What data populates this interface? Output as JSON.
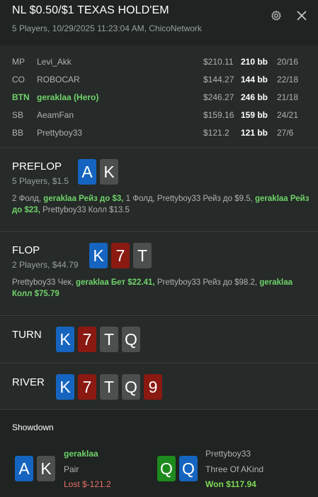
{
  "header": {
    "title": "NL $0.50/$1 TEXAS HOLD'EM",
    "subtitle": "5 Players, 10/29/2025 11:23:04 AM, ChicoNetwork",
    "icons": [
      "gear-icon",
      "close-icon"
    ]
  },
  "players": [
    {
      "pos": "MP",
      "name": "Levi_Akk",
      "stack": "$210.11",
      "bb": "210 bb",
      "hands": "20/16"
    },
    {
      "pos": "CO",
      "name": "ROBOCAR",
      "stack": "$144.27",
      "bb": "144 bb",
      "hands": "22/18"
    },
    {
      "pos": "BTN",
      "name": "geraklaa (Hero)",
      "stack": "$246.27",
      "bb": "246 bb",
      "hands": "21/18"
    },
    {
      "pos": "SB",
      "name": "AeamFan",
      "stack": "$159.16",
      "bb": "159 bb",
      "hands": "24/21"
    },
    {
      "pos": "BB",
      "name": "Prettyboy33",
      "stack": "$121.2",
      "bb": "121 bb",
      "hands": "27/6"
    }
  ],
  "preflop": {
    "title": "PREFLOP",
    "sub": "5 Players, $1.5",
    "cards": [
      "A",
      "K"
    ],
    "actions": [
      {
        "text": "2 Фолд, ",
        "hero": false
      },
      {
        "text": "geraklaa Рейз до $3,",
        "hero": true
      },
      {
        "text": " 1 Фолд, Prettyboy33 Рейз до $9.5, ",
        "hero": false
      },
      {
        "text": "geraklaa Рейз до $23,",
        "hero": true
      },
      {
        "text": " Prettyboy33 Колл $13.5",
        "hero": false
      }
    ]
  },
  "flop": {
    "title": "FLOP",
    "sub": "2 Players, $44.79",
    "cards": [
      "K",
      "7",
      "T"
    ],
    "actions": [
      {
        "text": "Prettyboy33 Чек, ",
        "hero": false
      },
      {
        "text": "geraklaa Бет $22.41,",
        "hero": true
      },
      {
        "text": " Prettyboy33 Рейз до $98.2, ",
        "hero": false
      },
      {
        "text": "geraklaa Колл $75.79",
        "hero": true
      }
    ]
  },
  "turn": {
    "title": "TURN",
    "cards": [
      "K",
      "7",
      "T",
      "Q"
    ]
  },
  "river": {
    "title": "RIVER",
    "cards": [
      "K",
      "7",
      "T",
      "Q",
      "9"
    ]
  },
  "showdown": {
    "title": "Showdown",
    "hero": {
      "name": "geraklaa",
      "hand": "Pair",
      "result": "Lost $-121.2",
      "cards": [
        "A",
        "K"
      ]
    },
    "villain": {
      "name": "Prettyboy33",
      "hand": "Three Of AKind",
      "result": "Won $117.94",
      "cards": [
        "Q",
        "Q"
      ]
    }
  },
  "colors": {
    "hero_green": "#6fd36b",
    "lost_red": "#e8706b",
    "won_green": "#7ed957",
    "card_blue": "#1565c0",
    "card_red": "#8a1912",
    "card_gray": "#4c4f4e",
    "card_green": "#1d8a1d"
  }
}
